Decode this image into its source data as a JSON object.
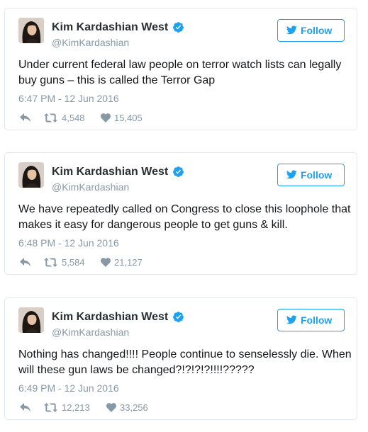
{
  "tweets": [
    {
      "user_name": "Kim Kardashian West",
      "handle": "@KimKardashian",
      "follow_label": "Follow",
      "text": "Under current federal law people on terror watch lists can legally buy guns – this is called the Terror Gap",
      "timestamp": "6:47 PM - 12 Jun 2016",
      "retweets": "4,548",
      "likes": "15,405"
    },
    {
      "user_name": "Kim Kardashian West",
      "handle": "@KimKardashian",
      "follow_label": "Follow",
      "text": "We have repeatedly called on Congress to close this loophole that makes it easy for dangerous people to get guns & kill.",
      "timestamp": "6:48 PM - 12 Jun 2016",
      "retweets": "5,584",
      "likes": "21,127"
    },
    {
      "user_name": "Kim Kardashian West",
      "handle": "@KimKardashian",
      "follow_label": "Follow",
      "text": "Nothing has changed!!!! People continue to senselessly die. When will these gun laws be changed?!?!?!?!!!!?????",
      "timestamp": "6:49 PM - 12 Jun 2016",
      "retweets": "12,213",
      "likes": "33,256"
    }
  ],
  "icons": {
    "verified": "verified-badge-icon",
    "follow": "twitter-bird-icon",
    "reply": "reply-icon",
    "retweet": "retweet-icon",
    "like": "heart-icon"
  },
  "colors": {
    "accent": "#1da1f2",
    "muted": "#8899a6",
    "text": "#14171a",
    "border": "#e1e8ed"
  }
}
